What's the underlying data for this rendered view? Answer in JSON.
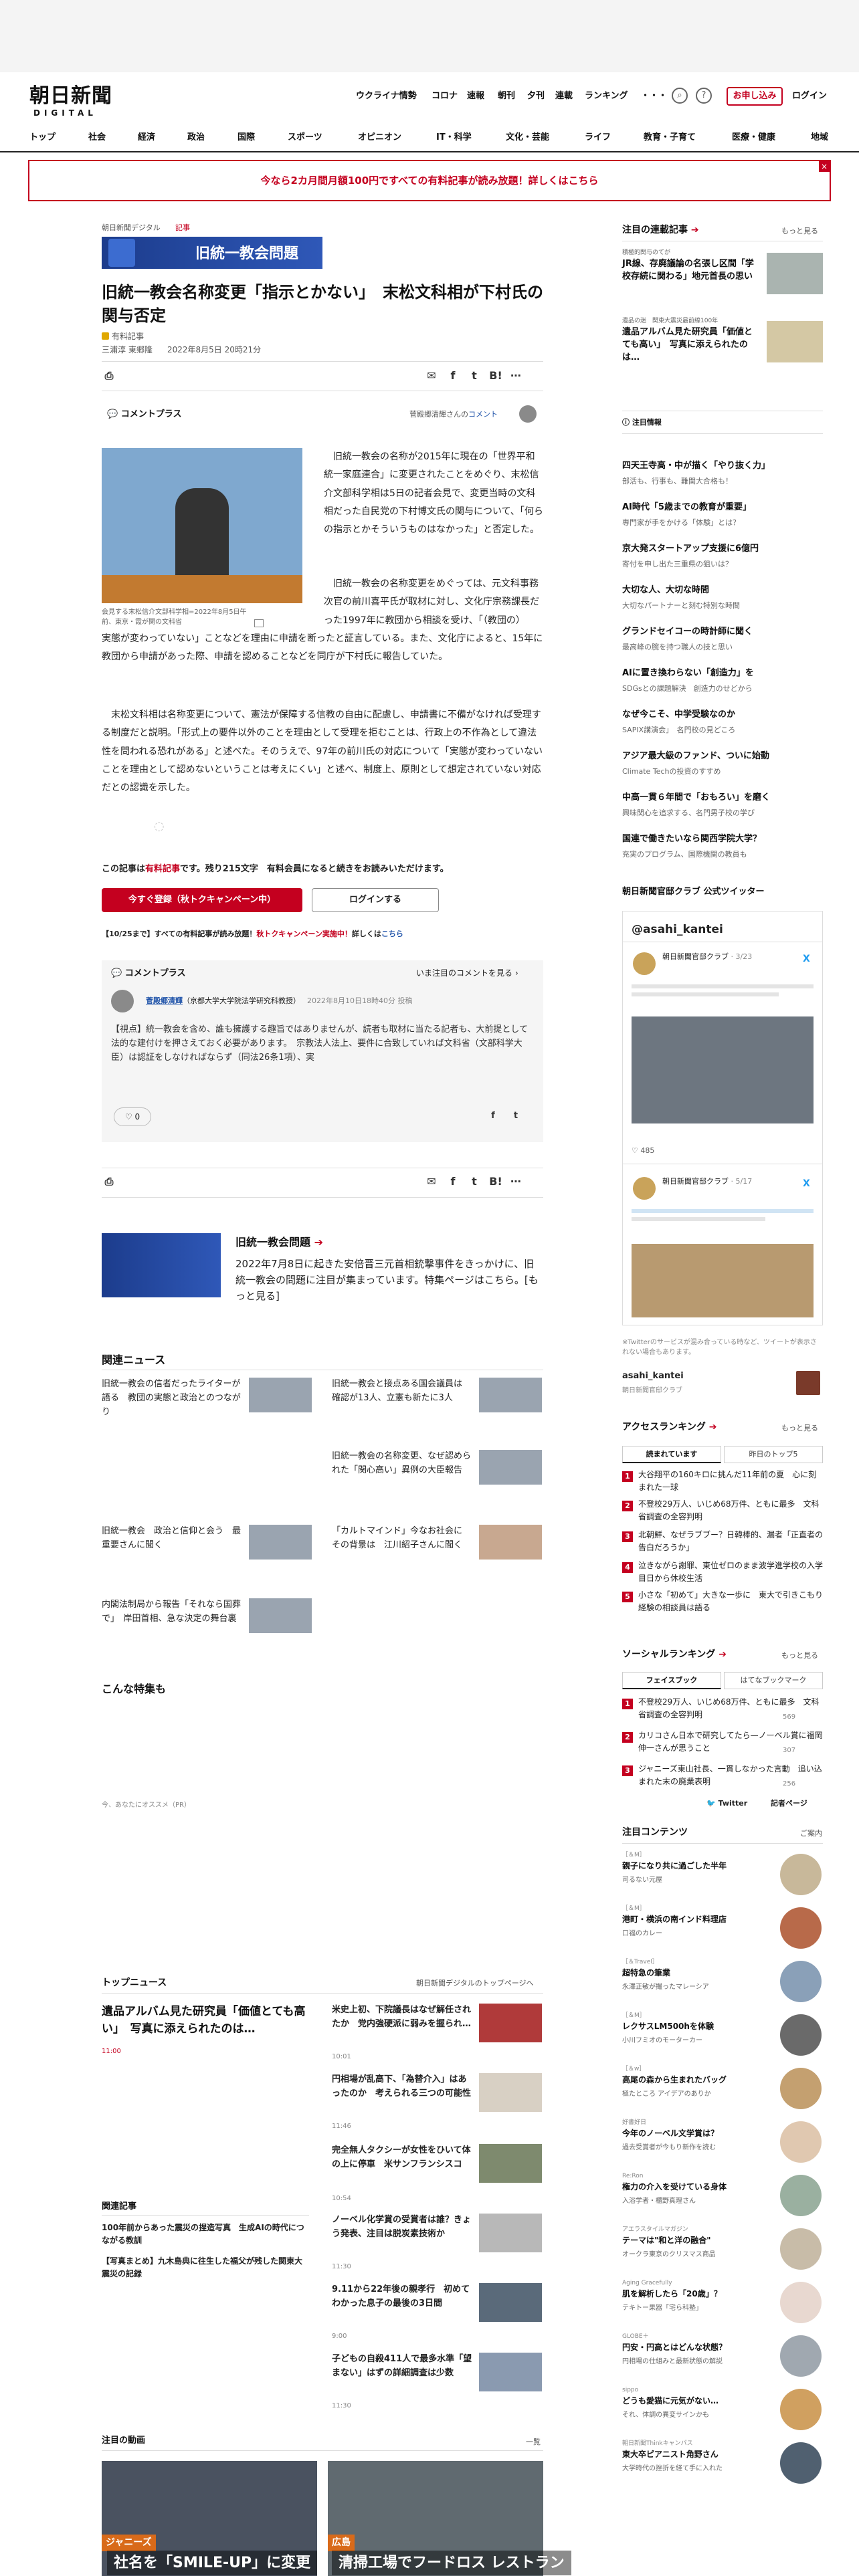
{
  "header": {
    "logo": "朝日新聞",
    "logo_sub": "DIGITAL",
    "util_links": [
      "ウクライナ情勢",
      "コロナ",
      "速報",
      "朝刊",
      "夕刊",
      "連載",
      "ランキング",
      "・・・"
    ],
    "signup": "お申し込み",
    "login": "ログイン"
  },
  "nav": [
    "トップ",
    "社会",
    "経済",
    "政治",
    "国際",
    "スポーツ",
    "オピニオン",
    "IT・科学",
    "文化・芸能",
    "ライフ",
    "教育・子育て",
    "医療・健康",
    "地域"
  ],
  "banner": {
    "text": "今なら2カ月間月額100円ですべての有料記事が読み放題！詳しくはこちら",
    "close": "×"
  },
  "article": {
    "breadcrumb": [
      "朝日新聞デジタル",
      "記事"
    ],
    "tag_label": "旧統一教会問題",
    "title": "旧統一教会名称変更「指示とかない」　末松文科相が下村氏の関与否定",
    "paid": "有料記事",
    "author": "三浦淳 東郷隆",
    "date": "2022年8月5日 20時21分",
    "comment_plus": "コメントプラス",
    "commenter_note": "菅殿郷清輝さんの",
    "commenter_link": "コメント",
    "para1": "旧統一教会の名称が2015年に現在の「世界平和統一家庭連合」に変更されたことをめぐり、末松信介文部科学相は5日の記者会見で、変更当時の文科相だった自民党の下村博文氏の関与について、「何らの指示とかそういうものはなかった」と否定した。",
    "para2": "旧統一教会の名称変更をめぐっては、元文科事務次官の前川喜平氏が取材に対し、文化庁宗務課長だった1997年に教団から相談を受け、「（教団の）実態が変わっていない」ことなどを理由に申請を断ったと証言している。また、文化庁によると、15年に教団から申請があった際、申請を認めることなどを同庁が下村氏に報告していた。",
    "para3": "末松文科相は名称変更について、憲法が保障する信教の自由に配慮し、申請書に不備がなければ受理する制度だと説明。「形式上の要件以外のことを理由として受理を拒むことは、行政上の不作為として違法性を問われる恐れがある」と述べた。そのうえで、97年の前川氏の対応について「実態が変わっていないことを理由として認めないということは考えにくい」と述べ、制度上、原則として想定されていない対応だとの認識を示した。",
    "photo_caption": "会見する末松信介文部科学相=2022年8月5日午前、東京・霞が関の文科省",
    "paywall_note_prefix": "この記事は",
    "paywall_note_link": "有料記事",
    "paywall_note_suffix": "です。残り215文字　有料会員になると続きをお読みいただけます。",
    "btn_register": "今すぐ登録（秋トクキャンペーン中）",
    "btn_login": "ログインする",
    "campaign_prefix": "【10/25まで】すべての有料記事が読み放題！",
    "campaign_link": "秋トクキャンペーン実施中！",
    "campaign_suffix": "詳しくは",
    "campaign_here": "こちら"
  },
  "comment": {
    "header": "コメントプラス",
    "more": "いま注目のコメントを見る",
    "name": "菅殿郷清輝",
    "affil": "（京都大学大学院法学研究科教授）",
    "date": "2022年8月10日18時40分 投稿",
    "tag": "【視点】",
    "text": "統一教会を含め、誰も擁護する趣旨ではありませんが、読者も取材に当たる記者も、大前提として法的な建付けを押さえておく必要があります。　宗教法人法上、要件に合致していれば文科省（文部科学大臣）は認証をしなければならず（同法26条1項）、実",
    "likes": "0"
  },
  "feature": {
    "title": "旧統一教会問題",
    "text": "2022年7月8日に起きた安倍晋三元首相銃撃事件をきっかけに、旧統一教会の問題に注目が集まっています。特集ページはこちら。[もっと見る]"
  },
  "related": {
    "heading": "関連ニュース",
    "items": [
      "旧統一教会の信者だったライターが語る　教団の実態と政治とのつながり",
      "旧統一教会と接点ある国会議員は　確認が13人、立憲も新たに3人",
      "旧統一教会の名称変更、なぜ認められた「関心高い」異例の大臣報告",
      "旧統一教会　政治と信仰と会う　最重要さんに聞く",
      "「カルトマインド」今なお社会に　その背景は　江川紹子さんに聞く",
      "内閣法制局から報告「それなら国葬で」　岸田首相、急な決定の舞台裏"
    ]
  },
  "special": {
    "heading": "こんな特集も",
    "recommend": "今、あなたにオススメ（PR）"
  },
  "top_news": {
    "heading": "トップニュース",
    "more": "朝日新聞デジタルのトップページへ",
    "main_title": "遺品アルバム見た研究員「価値とても高い」　写真に添えられたのは…",
    "main_time": "11:00",
    "items": [
      {
        "title": "米史上初、下院議長はなぜ解任されたか　党内強硬派に弱みを握られ…",
        "time": "10:01"
      },
      {
        "title": "円相場が乱高下、「為替介入」はあったのか　考えられる三つの可能性",
        "time": "11:46"
      },
      {
        "title": "完全無人タクシーが女性をひいて体の上に停車　米サンフランシスコ",
        "time": "10:54"
      },
      {
        "title": "ノーベル化学賞の受賞者は誰？きょう発表、注目は脱炭素技術か",
        "time": "11:30"
      },
      {
        "title": "9.11から22年後の親孝行　初めてわかった息子の最後の3日間",
        "time": "9:00"
      },
      {
        "title": "子どもの自殺411人で最多水準「望まない」はずの詳細調査は少数",
        "time": "11:30"
      }
    ],
    "kanren_heading": "関連記事",
    "kanren": [
      "100年前からあった震災の捏造写真　生成AIの時代につながる教訓",
      "【写真まとめ】九木島典に往生した福父が残した関東大震災の記録"
    ]
  },
  "videos": {
    "heading": "注目の動画",
    "more": "一覧",
    "captions": [
      "社名を「SMILE-UP」に変更",
      "清掃工場でフードロス レストラン"
    ],
    "badge1": "ジャニーズ",
    "badge2": "広島"
  },
  "right": {
    "series_heading": "注目の連載記事",
    "more": "もっと見る",
    "series": [
      {
        "sub": "積極的関与のてが",
        "title": "JR線、存廃議論の名張し区間「学校存続に関わる」地元首長の思い"
      },
      {
        "sub": "遺品の迷　関東大震災最前線100年",
        "title": "遺品アルバム見た研究員「価値とても高い」　写真に添えられたのは…"
      }
    ],
    "attention_heading": "注目情報",
    "attention": [
      {
        "title": "四天王寺高・中が描く「やり抜く力」",
        "sub": "部活も、行事も、難関大合格も！"
      },
      {
        "title": "AI時代「5歳までの教育が重要」",
        "sub": "専門家が手をかける「体験」とは？"
      },
      {
        "title": "京大発スタートアップ支援に6億円",
        "sub": "寄付を申し出た三重県の狙いは？"
      },
      {
        "title": "大切な人、大切な時間",
        "sub": "大切なパートナーと刻む特別な時間"
      },
      {
        "title": "グランドセイコーの時計師に聞く",
        "sub": "最高峰の腕を持つ職人の技と思い"
      },
      {
        "title": "AIに置き換わらない「創造力」を",
        "sub": "SDGsとの課題解決　創造力のせどから"
      },
      {
        "title": "なぜ今こそ、中学受験なのか",
        "sub": "SAPIX講演会」　名門校の見どころ"
      },
      {
        "title": "アジア最大級のファンド、ついに始動",
        "sub": "Climate Techの投資のすすめ"
      },
      {
        "title": "中高一貫６年間で「おもろい」を磨く",
        "sub": "興味関心を追求する、名門男子校の学び"
      },
      {
        "title": "国連で働きたいなら関西学院大学？",
        "sub": "充実のプログラム、国際機関の教員も"
      }
    ],
    "twitter_heading": "朝日新聞官邸クラブ 公式ツイッター",
    "twitter_account": "@asahi_kantei",
    "twitter_name": "朝日新聞官邸クラブ",
    "tweet1_date": "3/23",
    "tweet2_date": "5/17",
    "tweet_stats": "485",
    "twitter_note": "※Twitterのサービスが混み合っている時など、ツイートが表示されない場合もあります。",
    "twitter_footer_name": "asahi_kantei",
    "twitter_footer_sub": "朝日新聞官邸クラブ",
    "access_heading": "アクセスランキング",
    "access_tabs": [
      "読まれています",
      "昨日のトップ5"
    ],
    "access": [
      "大谷翔平の160キロに挑んだ11年前の夏　心に刻まれた一球",
      "不登校29万人、いじめ68万件、ともに最多　文科省調査の全容判明",
      "北朝鮮、なぜラブブー？日韓棒的、漏者「正直者の告白だろうか」",
      "泣きながら謝罪、東位ゼロのまま波学進学校の入学目日から休校生活",
      "小さな「初めて」大きな一歩に　東大で引きこもり経験の相談員は語る"
    ],
    "social_heading": "ソーシャルランキング",
    "social_tabs": [
      "フェイスブック",
      "はてなブックマーク"
    ],
    "social": [
      {
        "text": "不登校29万人、いじめ68万件、ともに最多　文科省調査の全容判明",
        "count": "569"
      },
      {
        "text": "カリコさん日本で研究してたら—ノーベル賞に福岡伸一さんが思うこと",
        "count": "307"
      },
      {
        "text": "ジャニーズ東山社長、一貫しなかった言動　追い込まれた末の廃業表明",
        "count": "256"
      }
    ],
    "social_follow": "Twitter",
    "social_page": "記者ページ",
    "contents_heading": "注目コンテンツ",
    "contents_more": "ご案内",
    "contents": [
      {
        "brand": "［＆M］",
        "title": "親子になり共に過ごした半年",
        "sub": "司るない元屋"
      },
      {
        "brand": "［＆M］",
        "title": "港町・横浜の南インド料理店",
        "sub": "口福のカレー"
      },
      {
        "brand": "［＆Travel］",
        "title": "超特急の筆業",
        "sub": "永澤正敏が撮ったマレーシア"
      },
      {
        "brand": "［＆M］",
        "title": "レクサスLM500hを体験",
        "sub": "小川フミオのモーターカー"
      },
      {
        "brand": "［＆w］",
        "title": "高尾の森から生まれたバッグ",
        "sub": "極たところ アイデアのありか"
      },
      {
        "brand": "好書好日",
        "title": "今年のノーベル文学賞は？",
        "sub": "過去受賞者が今もり新作を読む"
      },
      {
        "brand": "Re:Ron",
        "title": "権力の介入を受けている身体",
        "sub": "入浴学者・櫃野真理さん"
      },
      {
        "brand": "アエラスタイルマガジン",
        "title": "テーマは\"和と洋の融合\"",
        "sub": "オークラ東京のクリスマス商品"
      },
      {
        "brand": "Aging Gracefully",
        "title": "肌を解析したら「20歳」？",
        "sub": "テキトー果器「宅ら科塾」"
      },
      {
        "brand": "GLOBE＋",
        "title": "円安・円高とはどんな状態？",
        "sub": "円相場の仕組みと最新状態の解説"
      },
      {
        "brand": "sippo",
        "title": "どうも愛猫に元気がない…",
        "sub": "それ、体調の異変サインかも"
      },
      {
        "brand": "朝日新聞Thinkキャンパス",
        "title": "東大卒ピアニスト角野さん",
        "sub": "大学時代の挫折を経て手に入れた"
      }
    ]
  }
}
